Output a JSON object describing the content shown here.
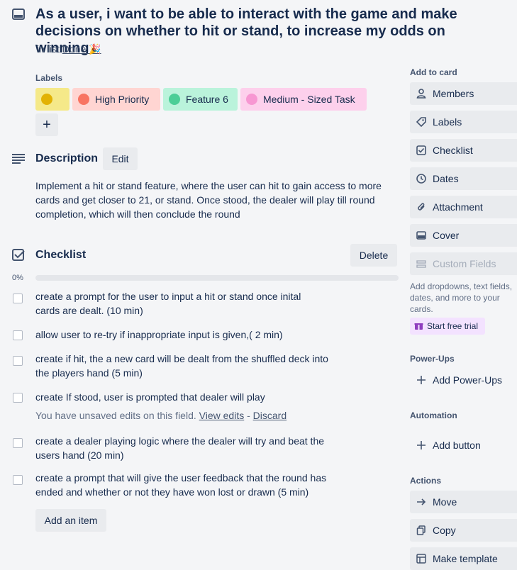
{
  "card": {
    "title": "As a user, i want to be able to interact with the game and make decisions on whether to hit or stand, to increase my odds on winning",
    "in_list_prefix": "in list",
    "list_name": "Done 🎉"
  },
  "labels": {
    "heading": "Labels",
    "items": [
      {
        "text": "",
        "color": "#f5e989",
        "dot": "#e2b203"
      },
      {
        "text": "High Priority",
        "color": "#ffd5d2",
        "dot": "#f87462"
      },
      {
        "text": "Feature 6",
        "color": "#baf3db",
        "dot": "#4bce97"
      },
      {
        "text": "Medium - Sized Task",
        "color": "#fdd0ec",
        "dot": "#f797d2"
      }
    ],
    "add_symbol": "+"
  },
  "description": {
    "heading": "Description",
    "edit_label": "Edit",
    "text": "Implement a hit or stand feature, where the user can hit to gain access to more cards and get closer to 21, or stand. Once stood, the dealer will play till round completion, which will then conclude the round"
  },
  "checklist": {
    "heading": "Checklist",
    "delete_label": "Delete",
    "progress": "0%",
    "progress_value": 0,
    "items": [
      {
        "text": "create a prompt for the user to input a hit or stand once inital cards are dealt. (10 min)"
      },
      {
        "text": "allow user to re-try if inappropriate input is given,( 2 min)"
      },
      {
        "text": "create if hit, the a new card will be dealt from the shuffled deck into the players hand (5 min)"
      },
      {
        "text": "create If stood, user is prompted that dealer will play"
      },
      {
        "text": "create a dealer playing logic where the dealer will try and beat the users hand (20 min)"
      },
      {
        "text": "create a prompt that will give the user feedback that the round has ended and whether or not they have won lost or drawn (5 min)"
      }
    ],
    "unsaved_text": "You have unsaved edits on this field.",
    "view_edits": "View edits",
    "separator": "-",
    "discard": "Discard",
    "add_item": "Add an item"
  },
  "sidebar": {
    "add_to_card": "Add to card",
    "members": "Members",
    "labels": "Labels",
    "checklist": "Checklist",
    "dates": "Dates",
    "attachment": "Attachment",
    "cover": "Cover",
    "custom_fields": "Custom Fields",
    "custom_fields_hint": "Add dropdowns, text fields, dates, and more to your cards.",
    "start_trial": "Start free trial",
    "powerups_heading": "Power-Ups",
    "add_powerups": "Add Power-Ups",
    "automation_heading": "Automation",
    "add_button": "Add button",
    "actions_heading": "Actions",
    "move": "Move",
    "copy": "Copy",
    "make_template": "Make template"
  }
}
